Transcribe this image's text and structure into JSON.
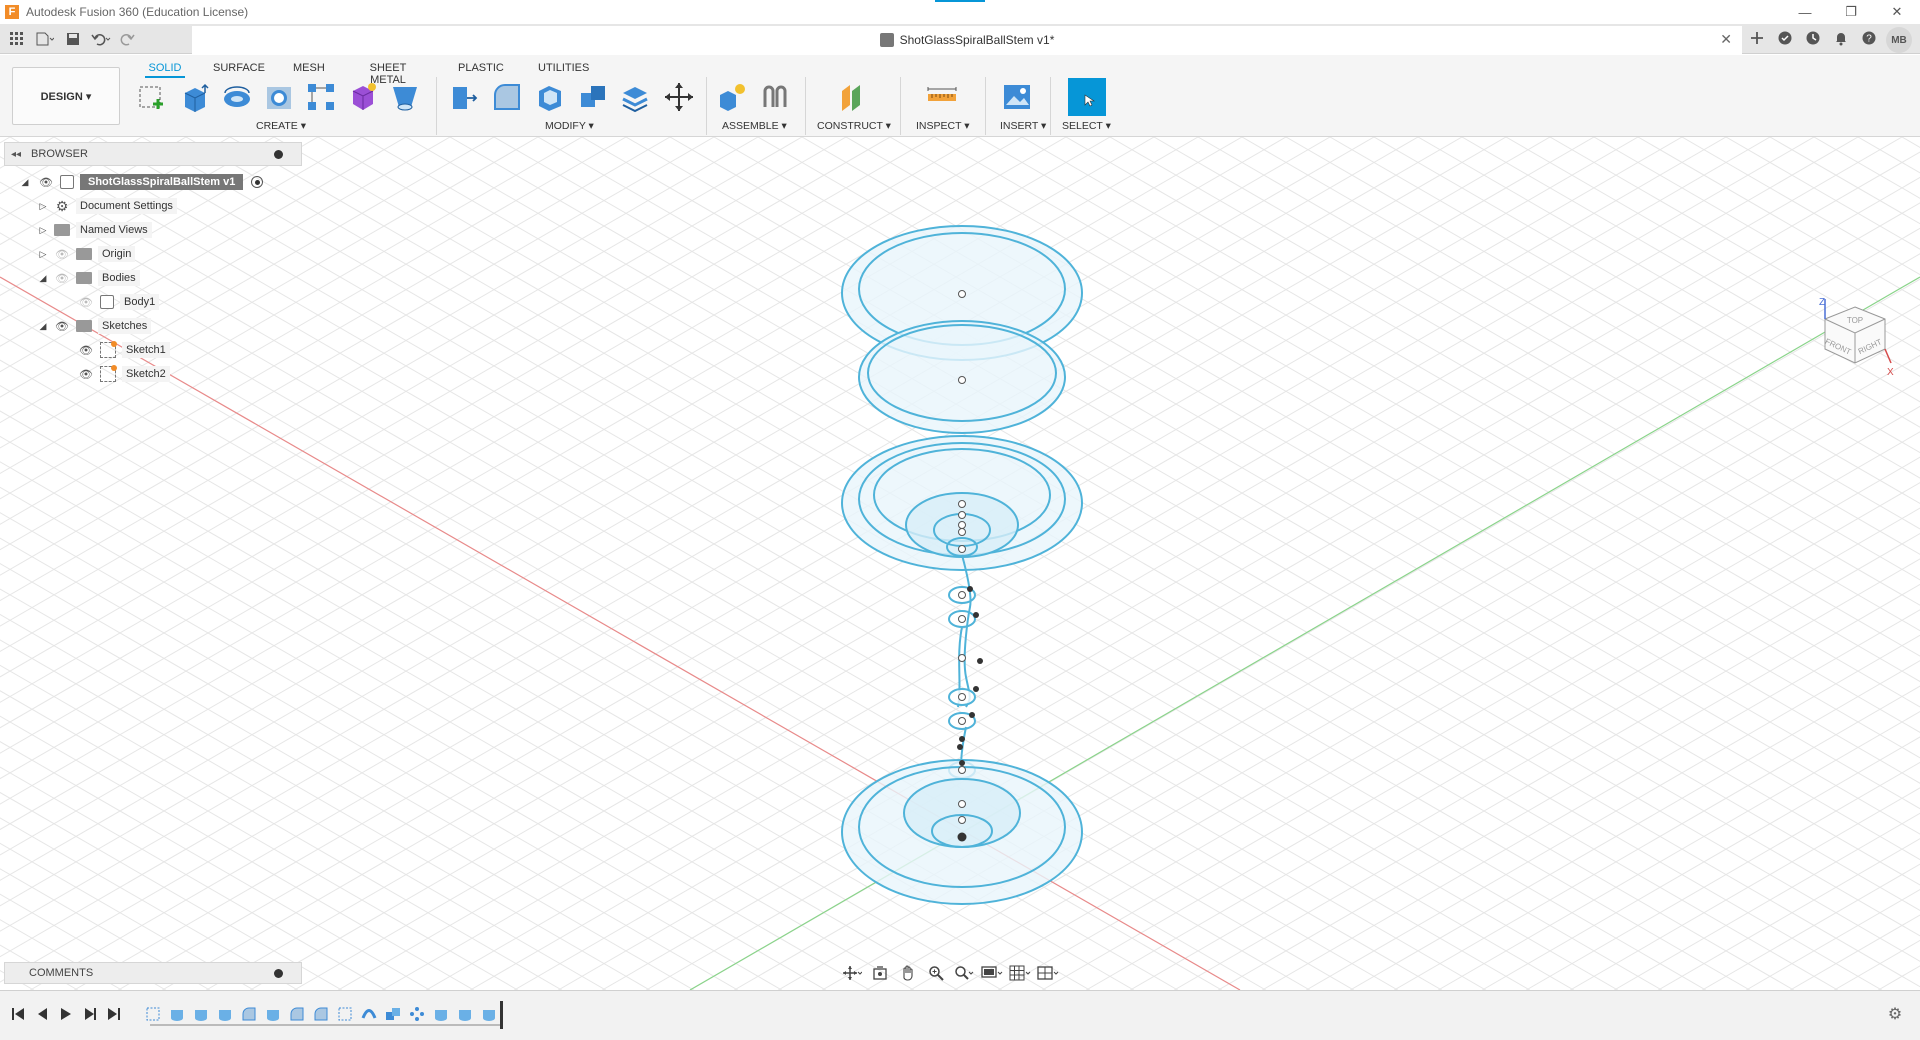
{
  "window": {
    "title": "Autodesk Fusion 360 (Education License)",
    "minimize": "—",
    "restore": "❐",
    "close": "✕"
  },
  "document": {
    "tab_title": "ShotGlassSpiralBallStem v1*",
    "close": "✕"
  },
  "user": {
    "initials": "MB"
  },
  "ribbon": {
    "workspace": "DESIGN ▾",
    "tabs": [
      "SOLID",
      "SURFACE",
      "MESH",
      "SHEET METAL",
      "PLASTIC",
      "UTILITIES"
    ],
    "active_tab": "SOLID",
    "groups": {
      "create": "CREATE ▾",
      "modify": "MODIFY ▾",
      "assemble": "ASSEMBLE ▾",
      "construct": "CONSTRUCT ▾",
      "inspect": "INSPECT ▾",
      "insert": "INSERT ▾",
      "select": "SELECT ▾"
    }
  },
  "browser": {
    "title": "BROWSER",
    "collapse": "◂◂",
    "root": "ShotGlassSpiralBallStem v1",
    "items": [
      {
        "label": "Document Settings"
      },
      {
        "label": "Named Views"
      },
      {
        "label": "Origin"
      },
      {
        "label": "Bodies"
      },
      {
        "label": "Body1"
      },
      {
        "label": "Sketches"
      },
      {
        "label": "Sketch1"
      },
      {
        "label": "Sketch2"
      }
    ]
  },
  "comments": {
    "title": "COMMENTS"
  },
  "viewcube": {
    "top": "TOP",
    "front": "FRONT",
    "right": "RIGHT",
    "z": "Z",
    "x": "X"
  },
  "colors": {
    "accent": "#0696d7",
    "sketch": "#4fb3d9",
    "sketch_fill": "#e8f5fb",
    "axis_red": "#e88a8a",
    "axis_green": "#8ad48a"
  }
}
